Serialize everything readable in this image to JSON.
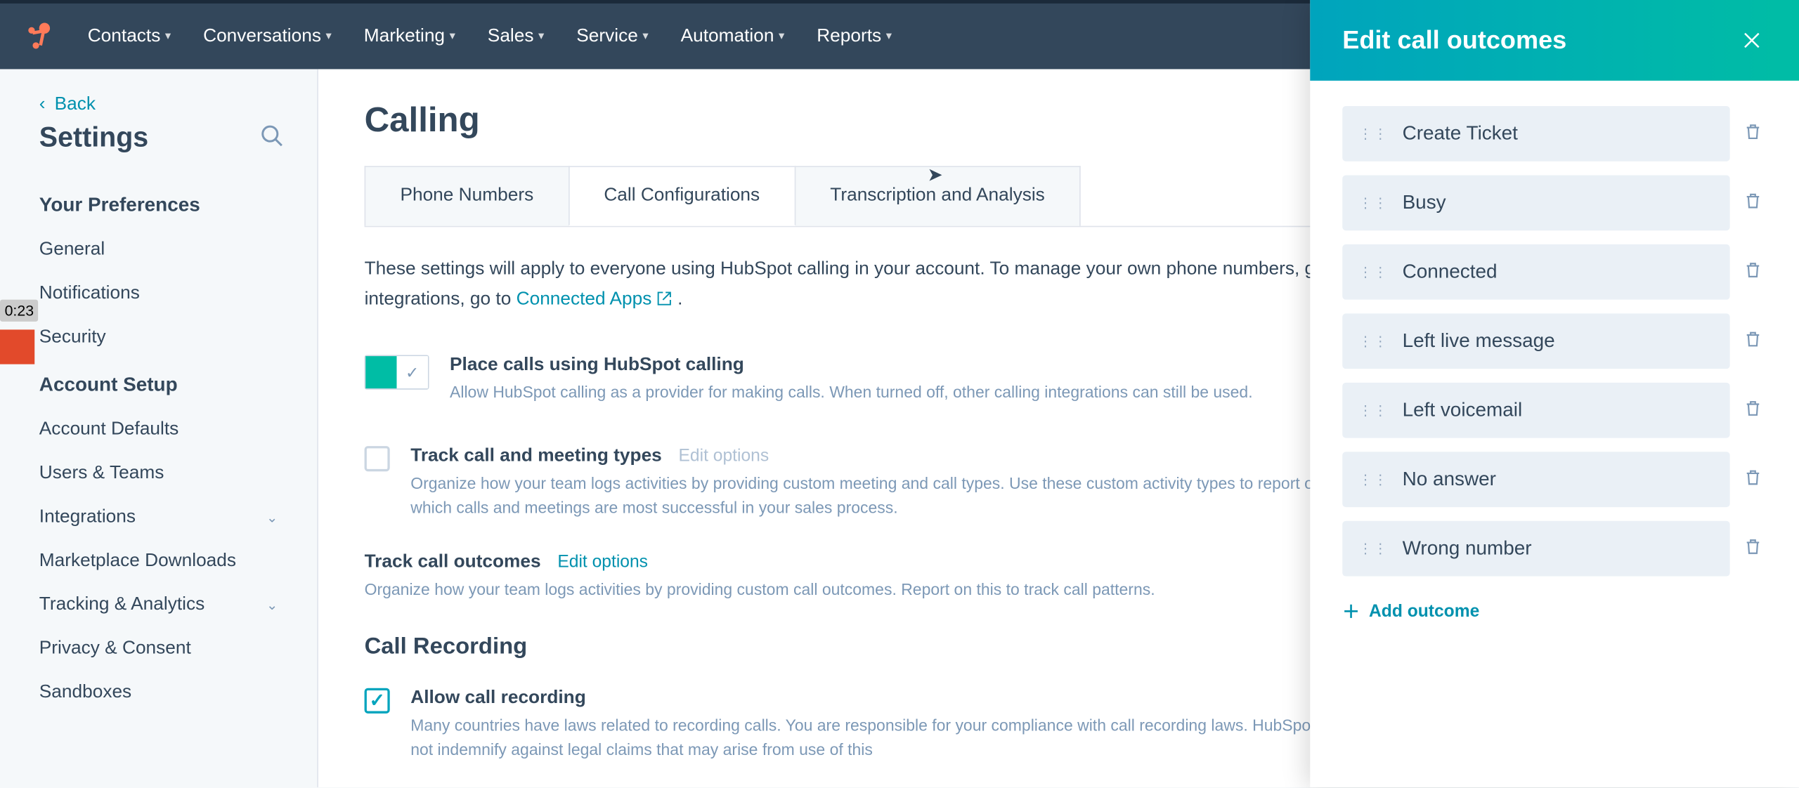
{
  "nav": {
    "items": [
      "Contacts",
      "Conversations",
      "Marketing",
      "Sales",
      "Service",
      "Automation",
      "Reports"
    ]
  },
  "sidebar": {
    "back": "Back",
    "title": "Settings",
    "prefs_header": "Your Preferences",
    "prefs": [
      "General",
      "Notifications",
      "Security"
    ],
    "setup_header": "Account Setup",
    "setup": [
      "Account Defaults",
      "Users & Teams",
      "Integrations",
      "Marketplace Downloads",
      "Tracking & Analytics",
      "Privacy & Consent",
      "Sandboxes"
    ],
    "expandable": {
      "Integrations": true,
      "Tracking & Analytics": true
    },
    "ts_badge": "0:23"
  },
  "main": {
    "title": "Calling",
    "tabs": [
      "Phone Numbers",
      "Call Configurations",
      "Transcription and Analysis"
    ],
    "active_tab": 1,
    "desc_prefix": "These settings will apply to everyone using HubSpot calling in your account. To manage your own phone numbers, g",
    "desc_mid": "integrations, go to ",
    "connected_apps": "Connected Apps",
    "desc_suffix": " .",
    "place_calls": {
      "title": "Place calls using HubSpot calling",
      "help": "Allow HubSpot calling as a provider for making calls. When turned off, other calling integrations can still be used."
    },
    "track_types": {
      "title": "Track call and meeting types",
      "edit": "Edit options",
      "help": "Organize how your team logs activities by providing custom meeting and call types. Use these custom activity types to report on which calls and meetings are most successful in your sales process."
    },
    "track_outcomes": {
      "title": "Track call outcomes",
      "edit": "Edit options",
      "help": "Organize how your team logs activities by providing custom call outcomes. Report on this to track call patterns."
    },
    "recording_header": "Call Recording",
    "allow_recording": {
      "title": "Allow call recording",
      "help": "Many countries have laws related to recording calls. You are responsible for your compliance with call recording laws. HubSpot does not indemnify against legal claims that may arise from use of this"
    }
  },
  "panel": {
    "title": "Edit call outcomes",
    "outcomes": [
      "Create Ticket",
      "Busy",
      "Connected",
      "Left live message",
      "Left voicemail",
      "No answer",
      "Wrong number"
    ],
    "add": "Add outcome"
  }
}
